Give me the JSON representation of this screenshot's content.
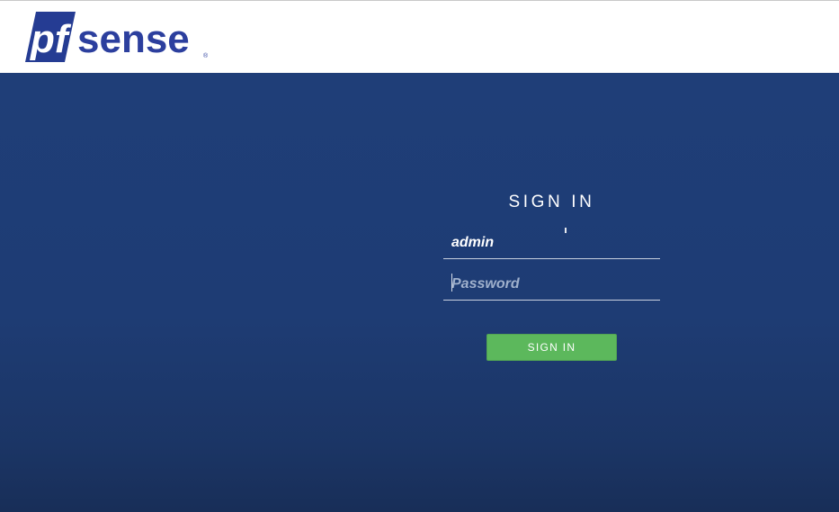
{
  "brand": {
    "logo_text_pf": "pf",
    "logo_text_sense": "sense",
    "logo_registered": "®",
    "colors": {
      "logo_box": "#253c93",
      "logo_text": "#2c3f9e"
    }
  },
  "login": {
    "title": "SIGN IN",
    "username_value": "admin",
    "password_placeholder": "Password",
    "submit_label": "SIGN IN"
  },
  "colors": {
    "header_bg": "#ffffff",
    "main_bg": "#1e3c74",
    "button_bg": "#5cb85c",
    "text": "#ffffff"
  }
}
